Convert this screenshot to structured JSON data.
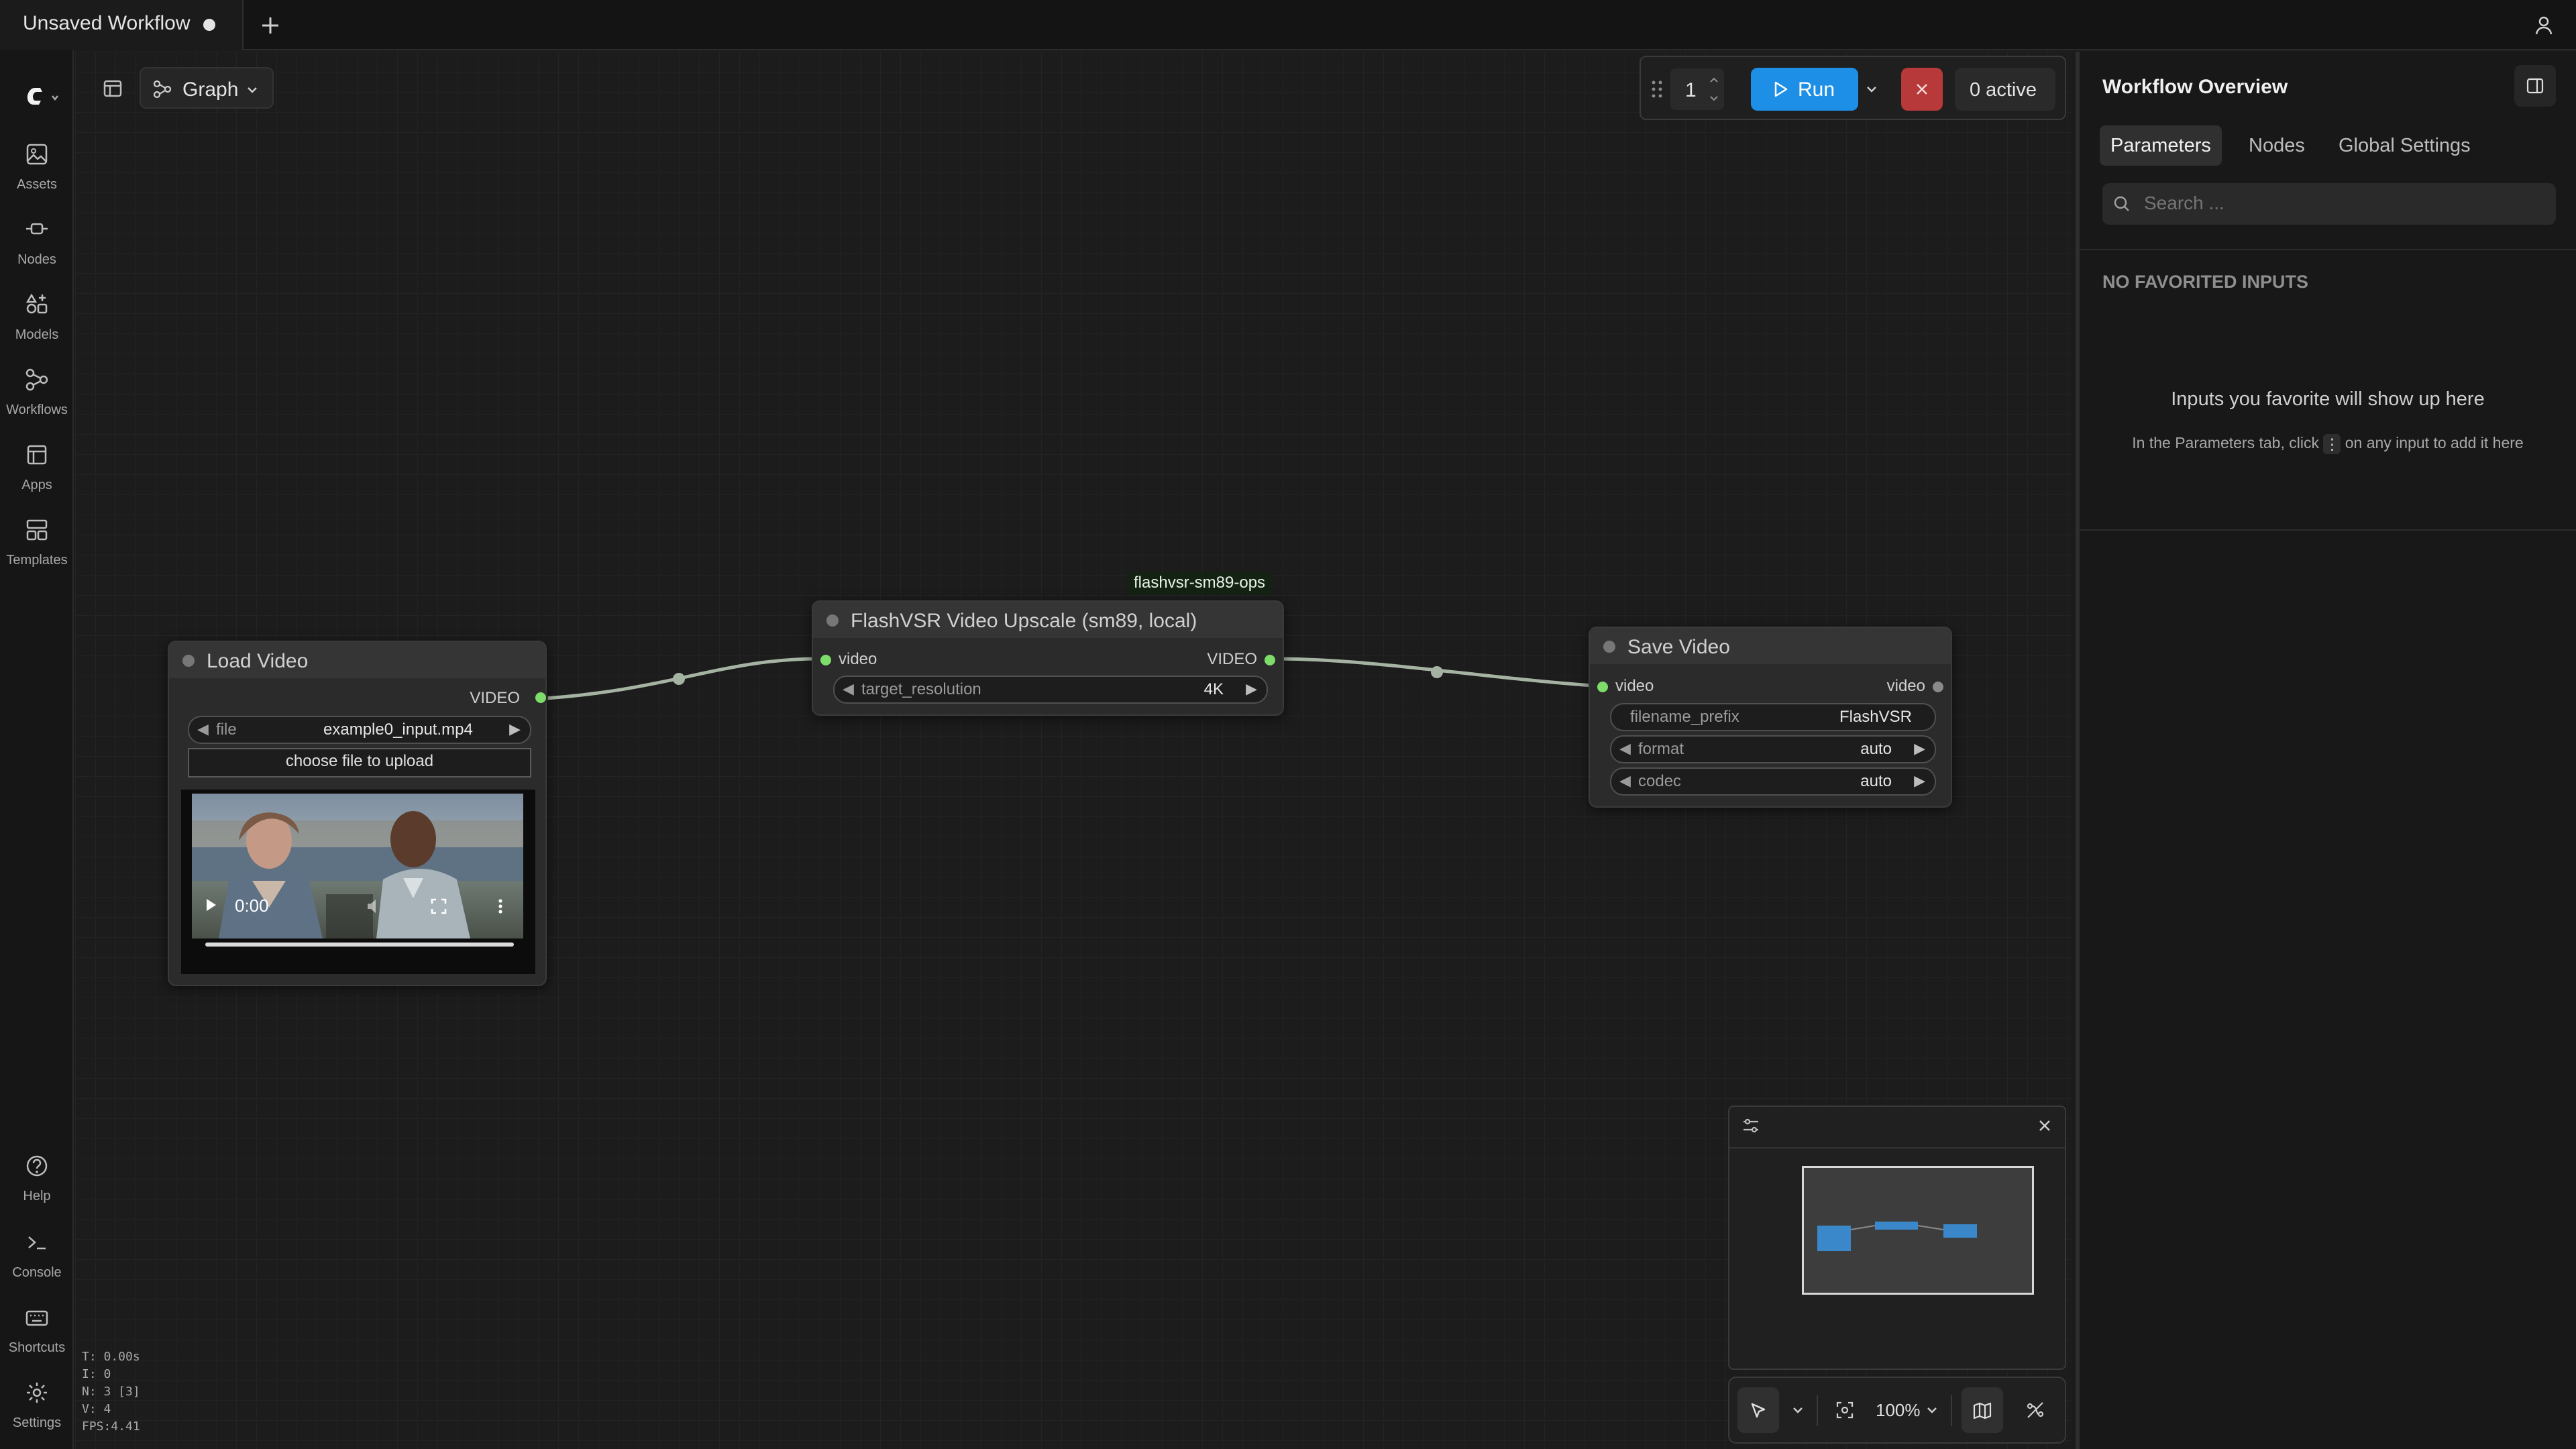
{
  "tabs": {
    "active_title": "Unsaved Workflow",
    "new_tab_icon": "plus-icon",
    "user_icon": "user-icon"
  },
  "sidebar": {
    "logo_icon": "comfy-logo-icon",
    "items": [
      {
        "label": "Assets",
        "icon": "image-icon"
      },
      {
        "label": "Nodes",
        "icon": "node-plug-icon"
      },
      {
        "label": "Models",
        "icon": "models-icon"
      },
      {
        "label": "Workflows",
        "icon": "workflow-icon"
      },
      {
        "label": "Apps",
        "icon": "apps-icon"
      },
      {
        "label": "Templates",
        "icon": "templates-icon"
      }
    ],
    "bottom_items": [
      {
        "label": "Help",
        "icon": "help-icon"
      },
      {
        "label": "Console",
        "icon": "terminal-icon"
      },
      {
        "label": "Shortcuts",
        "icon": "keyboard-icon"
      },
      {
        "label": "Settings",
        "icon": "gear-icon"
      }
    ]
  },
  "canvas_toolbar": {
    "view_mode": "Graph"
  },
  "run_bar": {
    "batch_count": "1",
    "run_label": "Run",
    "active_label": "0 active"
  },
  "nodes": {
    "load_video": {
      "title": "Load Video",
      "output_label": "VIDEO",
      "file_label": "file",
      "file_value": "example0_input.mp4",
      "upload_label": "choose file to upload",
      "player_time": "0:00"
    },
    "upscale": {
      "badge": "flashvsr-sm89-ops",
      "title": "FlashVSR Video Upscale (sm89, local)",
      "input_label": "video",
      "output_label": "VIDEO",
      "widget_label": "target_resolution",
      "widget_value": "4K"
    },
    "save_video": {
      "title": "Save Video",
      "input_label": "video",
      "output_label": "video",
      "widgets": [
        {
          "label": "filename_prefix",
          "value": "FlashVSR"
        },
        {
          "label": "format",
          "value": "auto"
        },
        {
          "label": "codec",
          "value": "auto"
        }
      ]
    }
  },
  "panel": {
    "title": "Workflow Overview",
    "tabs": [
      "Parameters",
      "Nodes",
      "Global Settings"
    ],
    "active_tab": "Parameters",
    "search_placeholder": "Search ...",
    "section_heading": "NO FAVORITED INPUTS",
    "empty_title": "Inputs you favorite will show up here",
    "hint_before": "In the Parameters tab, click",
    "hint_after": "on any input to add it here"
  },
  "bottom_controls": {
    "zoom": "100%"
  },
  "stats": {
    "t": "T: 0.00s",
    "i": "I: 0",
    "n": "N: 3 [3]",
    "v": "V: 4",
    "fps": "FPS:4.41"
  },
  "colors": {
    "accent_blue": "#1e8fe6",
    "socket_green": "#7ddc6a",
    "cancel_red": "#b8393a"
  }
}
